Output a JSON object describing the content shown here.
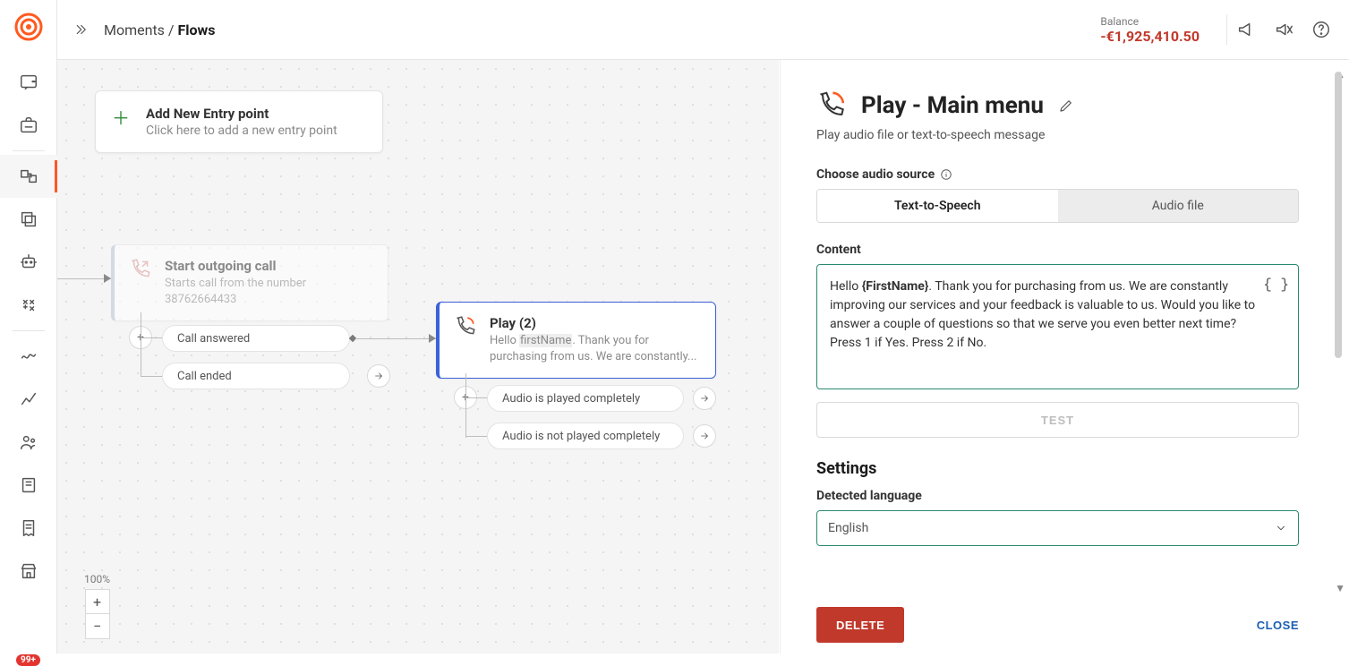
{
  "header": {
    "breadcrumb_root": "Moments",
    "breadcrumb_sep": "/",
    "breadcrumb_current": "Flows",
    "balance_label": "Balance",
    "balance_value": "-€1,925,410.50"
  },
  "nav": {
    "badge": "99+"
  },
  "canvas": {
    "zoom_label": "100%",
    "entry": {
      "title": "Add New Entry point",
      "sub": "Click here to add a new entry point"
    },
    "start": {
      "title": "Start outgoing call",
      "sub_prefix": "Starts call from the number",
      "number": "38762664433"
    },
    "start_branches": {
      "answered": "Call answered",
      "ended": "Call ended"
    },
    "play": {
      "title": "Play (2)",
      "sub_prefix": "Hello ",
      "sub_var": "firstName",
      "sub_suffix": ". Thank you for purchasing from us. We are constantly..."
    },
    "play_branches": {
      "complete": "Audio is played completely",
      "incomplete": "Audio is not played completely"
    }
  },
  "panel": {
    "title": "Play - Main menu",
    "subtitle": "Play audio file or text-to-speech message",
    "audio_source_label": "Choose audio source",
    "seg_tts": "Text-to-Speech",
    "seg_file": "Audio file",
    "content_label": "Content",
    "content_prefix": "Hello ",
    "content_var": "{FirstName}",
    "content_body": ". Thank you for purchasing from us. We are constantly improving our services and your feedback is valuable to us. Would you like to answer a couple of questions so that we serve you even better next time? Press 1 if Yes. Press 2 if No.",
    "test_label": "TEST",
    "settings_label": "Settings",
    "detected_lang_label": "Detected language",
    "detected_lang_value": "English",
    "delete_label": "DELETE",
    "close_label": "CLOSE"
  }
}
